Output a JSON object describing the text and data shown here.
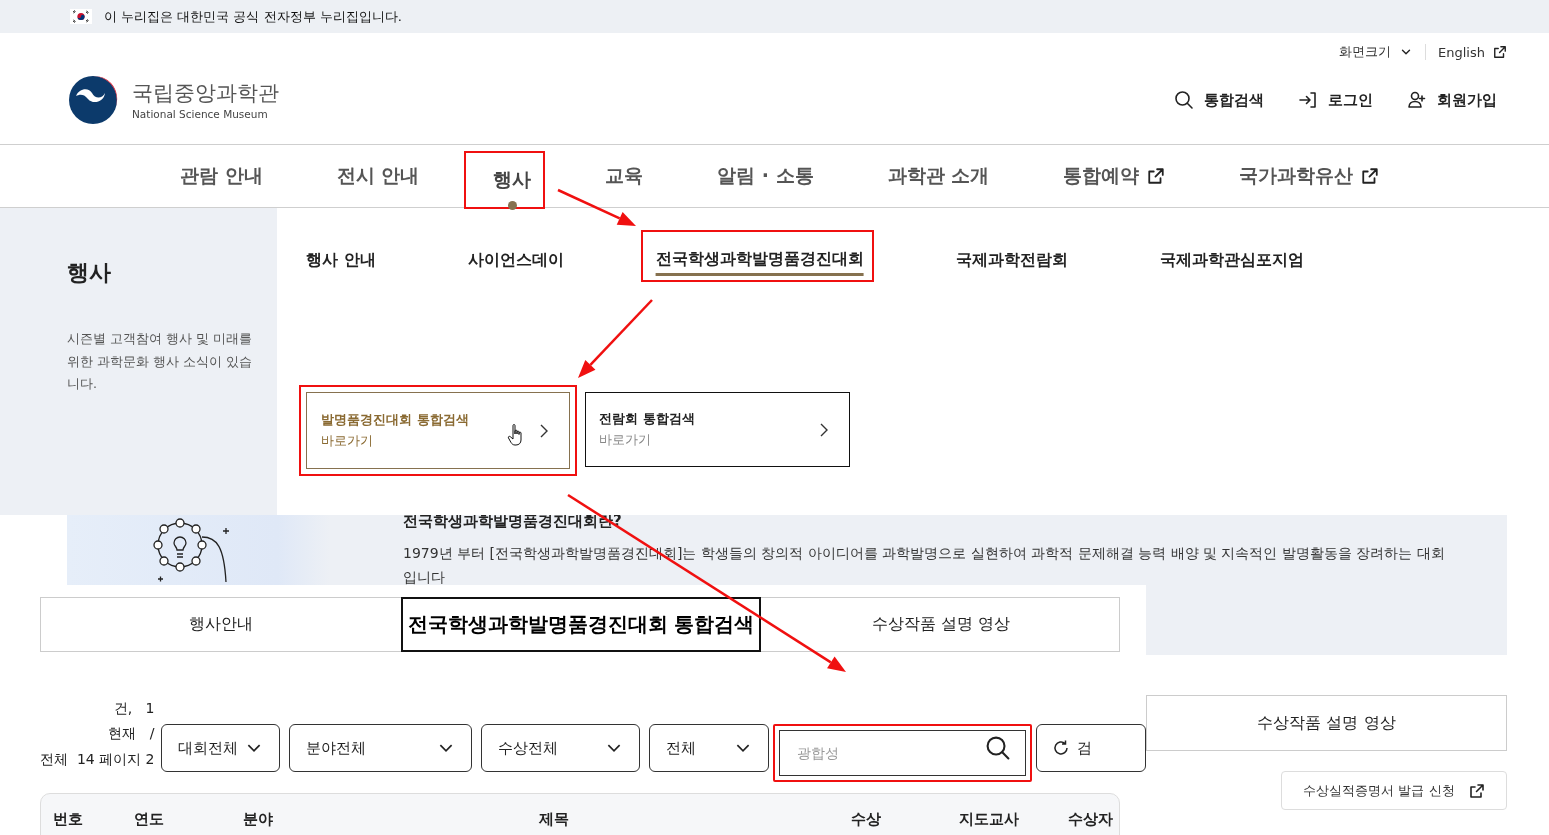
{
  "gov_banner": {
    "text": "이 누리집은 대한민국 공식 전자정부 누리집입니다."
  },
  "utility": [
    {
      "label": "화면크기",
      "kind": "dropdown"
    },
    {
      "label": "English",
      "kind": "external"
    }
  ],
  "logo": {
    "name": "국립중앙과학관",
    "subtitle": "National Science Museum"
  },
  "header_actions": [
    {
      "label": "통합검색",
      "kind": "search"
    },
    {
      "label": "로그인",
      "kind": "login"
    },
    {
      "label": "회원가입",
      "kind": "signup"
    }
  ],
  "nav": [
    {
      "label": "관람 안내",
      "selected": false,
      "external": false,
      "highlighted": false
    },
    {
      "label": "전시 안내",
      "selected": false,
      "external": false,
      "highlighted": false
    },
    {
      "label": "행사",
      "selected": true,
      "external": false,
      "highlighted": true
    },
    {
      "label": "교육",
      "selected": false,
      "external": false,
      "highlighted": false
    },
    {
      "label": "알림 · 소통",
      "selected": false,
      "external": false,
      "highlighted": false
    },
    {
      "label": "과학관 소개",
      "selected": false,
      "external": false,
      "highlighted": false
    },
    {
      "label": "통합예약",
      "selected": false,
      "external": true,
      "highlighted": false
    },
    {
      "label": "국가과학유산",
      "selected": false,
      "external": true,
      "highlighted": false
    }
  ],
  "mega_menu": {
    "title": "행사",
    "description": "시즌별 고객참여 행사 및 미래를 위한 과학문화 행사 소식이 있습니다.",
    "items": [
      {
        "label": "행사 안내",
        "selected": false,
        "highlighted": false
      },
      {
        "label": "사이언스데이",
        "selected": false,
        "highlighted": false
      },
      {
        "label": "전국학생과학발명품경진대회",
        "selected": true,
        "highlighted": true
      },
      {
        "label": "국제과학전람회",
        "selected": false,
        "highlighted": false
      },
      {
        "label": "국제과학관심포지엄",
        "selected": false,
        "highlighted": false
      }
    ],
    "cards": [
      {
        "title": "발명품경진대회 통합검색",
        "subtitle": "바로가기",
        "selected": true,
        "highlighted": true,
        "cursor": true
      },
      {
        "title": "전람회 통합검색",
        "subtitle": "바로가기",
        "selected": false,
        "highlighted": false,
        "cursor": false
      }
    ]
  },
  "intro": {
    "title": "전국학생과학발명품경진대회란?",
    "text": "1979년 부터 [전국학생과학발명품경진대회]는 학생들의 창의적 아이디어를 과학발명으로 실현하여 과학적 문제해결 능력 배양 및 지속적인 발명활동을 장려하는 대회입니다"
  },
  "background_tab": {
    "label": "수상작품 설명 영상"
  },
  "certificate_button": {
    "label": "수상실적증명서 발급 신청",
    "external": true
  },
  "overlay": {
    "tabs": [
      {
        "label": "행사안내",
        "selected": false
      },
      {
        "label": "전국학생과학발명품경진대회 통합검색",
        "selected": true
      },
      {
        "label": "수상작품 설명 영상",
        "selected": false
      }
    ],
    "page_info": [
      "건,   1",
      "현재   /",
      "전체  14 페이지 2"
    ],
    "filters": [
      {
        "label": "대회전체"
      },
      {
        "label": "분야전체"
      },
      {
        "label": "수상전체"
      },
      {
        "label": "전체"
      }
    ],
    "search": {
      "placeholder": "광합성",
      "highlighted": true
    },
    "reset_button": {
      "label": "검"
    },
    "table": {
      "columns": [
        "번호",
        "연도",
        "분야",
        "제목",
        "수상",
        "지도교사",
        "수상자"
      ]
    }
  }
}
